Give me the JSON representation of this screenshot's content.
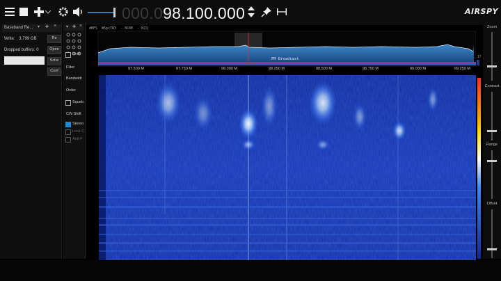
{
  "toolbar": {
    "frequency_dim": "000.0",
    "frequency_main": "98.100.000",
    "logo": "AIRSPY"
  },
  "baseband": {
    "title": "Baseband Re...",
    "write_label": "Write:",
    "write_value": "3.799 GB",
    "dropped_label": "Dropped buffers:",
    "dropped_value": "0",
    "buttons": [
      "Re",
      "Open",
      "Sche",
      "Conf"
    ]
  },
  "controls": {
    "shift_label": "Shift",
    "filter_label": "Filter",
    "bandwidth_label": "Bandwidt",
    "order_label": "Order",
    "squelch_label": "Squelc",
    "cw_shift_label": "CW Shift",
    "stereo_label": "Stereo",
    "lock_label": "Lock C",
    "anti_label": "Anti-F"
  },
  "spectrum": {
    "top_left": "dBFS",
    "info": "W5p<TRY  - 0C0E  - KCQ",
    "broadcast_label": "FM Broadcast",
    "scale_value": "17",
    "freq_ticks": [
      "97.500 M",
      "97.750 M",
      "98.000 M",
      "98.250 M",
      "98.500 M",
      "98.750 M",
      "99.000 M",
      "99.250 M"
    ]
  },
  "right_panel": {
    "zoom_label": "Zoom",
    "contrast_label": "Contrast",
    "range_label": "Range",
    "offset_label": "Offset"
  },
  "colors": {
    "accent": "#1d8bd1",
    "waterfall_bg": "#1232a8",
    "spectrum_fill": "#2a6fae"
  }
}
